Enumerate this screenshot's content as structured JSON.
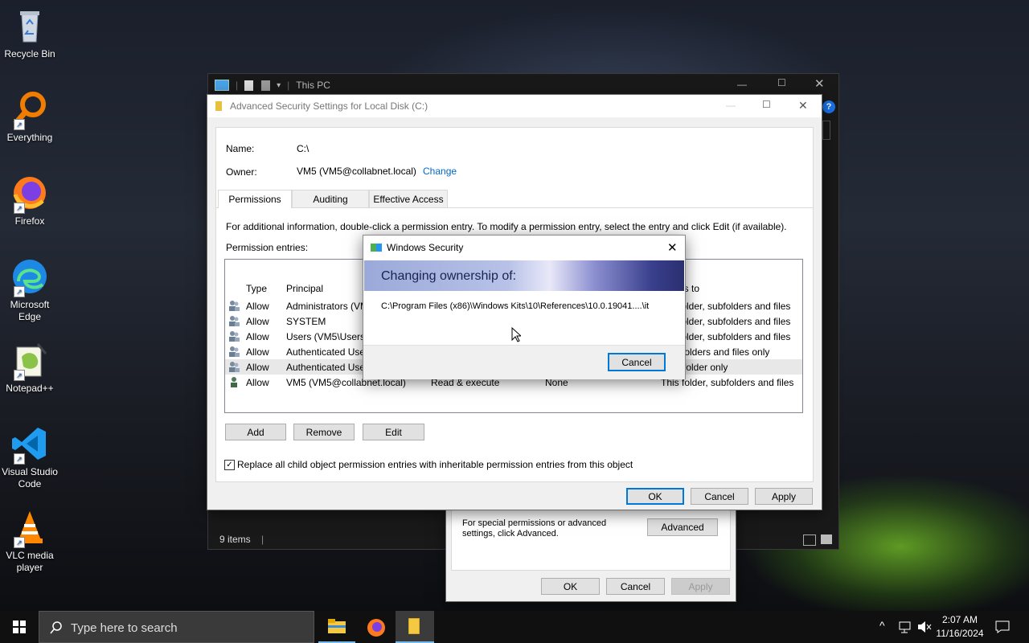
{
  "desktop": {
    "icons": [
      {
        "label": "Recycle Bin",
        "icon": "recycle-bin-icon"
      },
      {
        "label": "Everything",
        "icon": "everything-icon"
      },
      {
        "label": "Firefox",
        "icon": "firefox-icon"
      },
      {
        "label": "Microsoft Edge",
        "icon": "edge-icon"
      },
      {
        "label": "Notepad++",
        "icon": "notepadpp-icon"
      },
      {
        "label": "Visual Studio Code",
        "icon": "vscode-icon"
      },
      {
        "label": "VLC media player",
        "icon": "vlc-icon"
      }
    ]
  },
  "explorer": {
    "title": "This PC",
    "status_items": "9 items"
  },
  "advanced": {
    "title": "Advanced Security Settings for Local Disk (C:)",
    "name_label": "Name:",
    "name_value": "C:\\",
    "owner_label": "Owner:",
    "owner_value": "VM5 (VM5@collabnet.local)",
    "change_link": "Change",
    "tabs": [
      "Permissions",
      "Auditing",
      "Effective Access"
    ],
    "info_text": "For additional information, double-click a permission entry. To modify a permission entry, select the entry and click Edit (if available).",
    "entries_label": "Permission entries:",
    "columns": {
      "type": "Type",
      "principal": "Principal",
      "applies": "es to"
    },
    "rows": [
      {
        "type": "Allow",
        "principal": "Administrators (VM",
        "access": "",
        "inherited": "",
        "applies": "folder, subfolders and files"
      },
      {
        "type": "Allow",
        "principal": "SYSTEM",
        "access": "",
        "inherited": "",
        "applies": "folder, subfolders and files"
      },
      {
        "type": "Allow",
        "principal": "Users (VM5\\Users)",
        "access": "",
        "inherited": "",
        "applies": "folder, subfolders and files"
      },
      {
        "type": "Allow",
        "principal": "Authenticated Use",
        "access": "",
        "inherited": "",
        "applies": "folders and files only"
      },
      {
        "type": "Allow",
        "principal": "Authenticated Use",
        "access": "",
        "inherited": "",
        "applies": "folder only"
      },
      {
        "type": "Allow",
        "principal": "VM5 (VM5@collabnet.local)",
        "access": "Read & execute",
        "inherited": "None",
        "applies": "This folder, subfolders and files"
      }
    ],
    "add_btn": "Add",
    "remove_btn": "Remove",
    "edit_btn": "Edit",
    "replace_checkbox": "Replace all child object permission entries with inheritable permission entries from this object",
    "ok_btn": "OK",
    "cancel_btn": "Cancel",
    "apply_btn": "Apply"
  },
  "properties": {
    "special_text": "For special permissions or advanced settings, click Advanced.",
    "advanced_btn": "Advanced",
    "ok_btn": "OK",
    "cancel_btn": "Cancel",
    "apply_btn": "Apply"
  },
  "security_dialog": {
    "title": "Windows Security",
    "banner": "Changing ownership of:",
    "path": "C:\\Program Files (x86)\\Windows Kits\\10\\References\\10.0.19041....\\it",
    "cancel_btn": "Cancel"
  },
  "taskbar": {
    "search_placeholder": "Type here to search",
    "time": "2:07 AM",
    "date": "11/16/2024"
  }
}
